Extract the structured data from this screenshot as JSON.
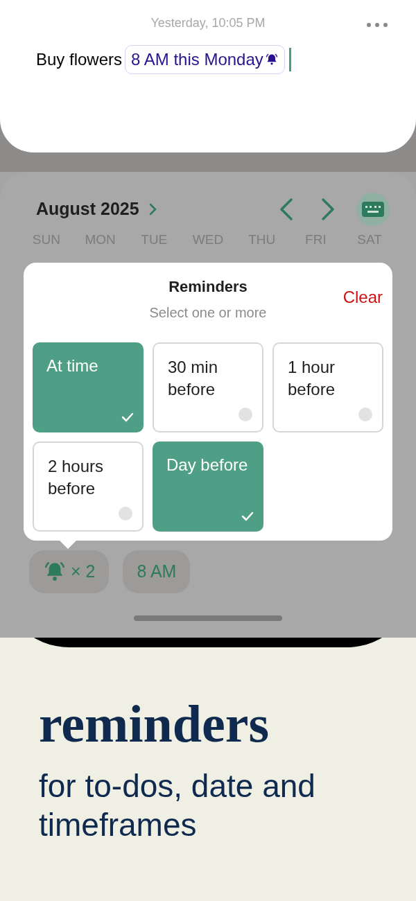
{
  "note": {
    "timestamp": "Yesterday, 10:05 PM",
    "text": "Buy flowers",
    "date_chip": "8 AM this Monday"
  },
  "calendar": {
    "month": "August 2025",
    "weekdays": [
      "SUN",
      "MON",
      "TUE",
      "WED",
      "THU",
      "FRI",
      "SAT"
    ]
  },
  "reminders": {
    "title": "Reminders",
    "subtitle": "Select one or more",
    "clear": "Clear",
    "options": [
      {
        "label": "At time",
        "selected": true
      },
      {
        "label": "30 min before",
        "selected": false
      },
      {
        "label": "1 hour before",
        "selected": false
      },
      {
        "label": "2 hours before",
        "selected": false
      },
      {
        "label": "Day before",
        "selected": true
      }
    ]
  },
  "chips": [
    {
      "kind": "reminder",
      "label": "× 2"
    },
    {
      "kind": "time",
      "label": "8 AM"
    }
  ],
  "promo": {
    "headline": "reminders",
    "subtitle": "for to-dos, date and timeframes"
  }
}
